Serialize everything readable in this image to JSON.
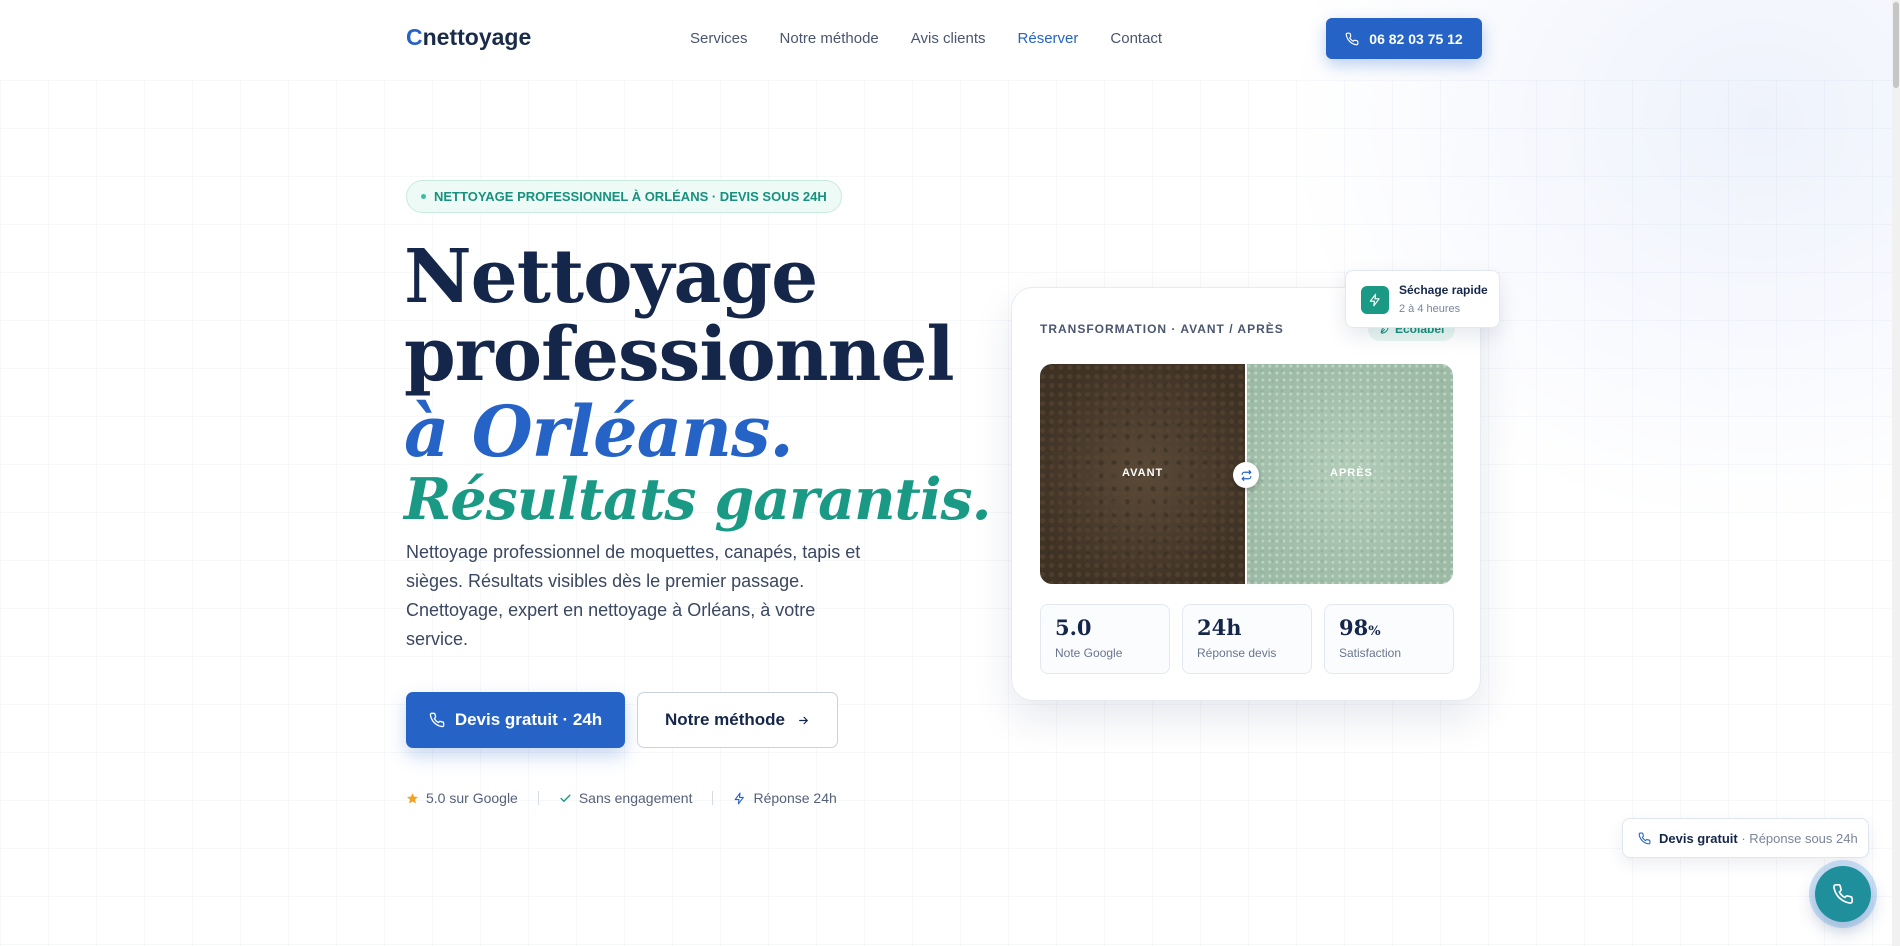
{
  "brand": {
    "logo_initial": "C",
    "logo_rest": "nettoyage"
  },
  "nav": {
    "links": [
      "Services",
      "Notre méthode",
      "Avis clients",
      "Réserver",
      "Contact"
    ],
    "phone_label": "06 82 03 75 12"
  },
  "hero": {
    "badge": "NETTOYAGE PROFESSIONNEL À ORLÉANS · DEVIS SOUS 24H",
    "title_line1": "Nettoyage",
    "title_line2": "professionnel",
    "title_line3": "à Orléans.",
    "title_line4": "Résultats garantis.",
    "lead": "Nettoyage professionnel de moquettes, canapés, tapis et sièges. Résultats visibles dès le premier passage. Cnettoyage, expert en nettoyage à Orléans, à votre service.",
    "primary_cta": "Devis gratuit · 24h",
    "secondary_cta": "Notre méthode",
    "trust": [
      "5.0 sur Google",
      "Sans engagement",
      "Réponse 24h"
    ]
  },
  "card": {
    "title": "TRANSFORMATION · AVANT / APRÈS",
    "eco_badge": "Ecolabel",
    "before_label": "AVANT",
    "after_label": "APRÈS",
    "stats": [
      {
        "value": "5.0",
        "unit": "",
        "label": "Note Google"
      },
      {
        "value": "24h",
        "unit": "",
        "label": "Réponse devis"
      },
      {
        "value": "98",
        "unit": "%",
        "label": "Satisfaction"
      }
    ]
  },
  "float_badge": {
    "title": "Séchage rapide",
    "subtitle": "2 à 4 heures"
  },
  "quote_pill": {
    "bold": "Devis gratuit",
    "rest": " · Réponse sous 24h"
  },
  "colors": {
    "primary": "#2563c7",
    "teal": "#1a9a85",
    "navy": "#15264b"
  },
  "icons": [
    "phone-icon",
    "arrow-right-icon",
    "star-icon",
    "check-icon",
    "bolt-icon",
    "leaf-icon",
    "swap-icon"
  ]
}
